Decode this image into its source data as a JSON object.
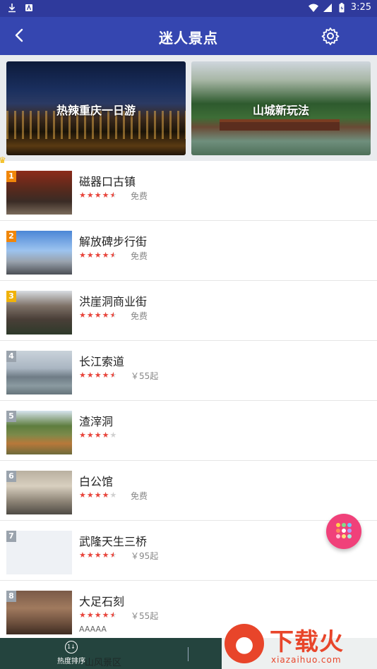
{
  "status": {
    "time": "3:25"
  },
  "appbar": {
    "title": "迷人景点"
  },
  "banners": [
    {
      "label": "热辣重庆一日游"
    },
    {
      "label": "山城新玩法"
    }
  ],
  "items": [
    {
      "rank": "1",
      "name": "磁器口古镇",
      "rating": 4.5,
      "price": "免费"
    },
    {
      "rank": "2",
      "name": "解放碑步行街",
      "rating": 4.5,
      "price": "免费"
    },
    {
      "rank": "3",
      "name": "洪崖洞商业街",
      "rating": 4.5,
      "price": "免费"
    },
    {
      "rank": "4",
      "name": "长江索道",
      "rating": 4.5,
      "price": "￥55起"
    },
    {
      "rank": "5",
      "name": "渣滓洞",
      "rating": 4,
      "price": ""
    },
    {
      "rank": "6",
      "name": "白公馆",
      "rating": 4,
      "price": "免费"
    },
    {
      "rank": "7",
      "name": "武隆天生三桥",
      "rating": 4.5,
      "price": "￥95起"
    },
    {
      "rank": "8",
      "name": "大足石刻",
      "rating": 4.5,
      "price": "￥55起",
      "extra": "AAAAA"
    }
  ],
  "bottom": {
    "sort_label": "热度排序",
    "partial_text": "山风景区"
  },
  "watermark": {
    "brand": "下载火",
    "url": "xiazaihuo.com"
  },
  "colors": {
    "appbar": "#3546b0",
    "star": "#e8453c",
    "fab": "#f0417a"
  }
}
